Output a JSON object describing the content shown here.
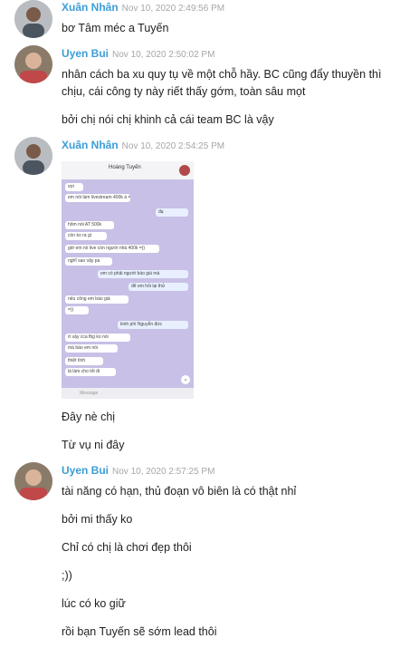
{
  "messages": [
    {
      "name": "Xuân Nhân",
      "time": "Nov 10, 2020 2:49:56 PM",
      "lines": [
        "bơ Tâm méc a Tuyến"
      ]
    },
    {
      "name": "Uyen Bui",
      "time": "Nov 10, 2020 2:50:02 PM",
      "lines": [
        "nhân cách ba xu quy tụ về một chỗ hầy. BC cũng đẩy thuyền thì chịu, cái công ty này riết thấy gớm, toàn sâu mọt",
        "bởi chị nói chị khinh cả cái team BC là vậy"
      ]
    },
    {
      "name": "Xuân Nhân",
      "time": "Nov 10, 2020 2:54:25 PM",
      "lines": [
        "Đây nè chị",
        "Từ vụ ni đây"
      ]
    },
    {
      "name": "Uyen Bui",
      "time": "Nov 10, 2020 2:57:25 PM",
      "lines": [
        "tài năng có hạn, thủ đoạn vô biên là có thật nhỉ",
        "bởi mi thấy ko",
        "Chỉ có chị là chơi đẹp thôi",
        ";))",
        "lúc có ko giữ",
        "rồi bạn Tuyến sẽ sớm lead thôi"
      ]
    }
  ],
  "screenshot": {
    "contact": "Hoàng Tuyến",
    "bubbles": [
      "vợi",
      "em nói làm livestream 400k à =))",
      "đạ",
      "hôm nói AT 500k",
      "còn ko ra gì",
      "giờ em nó live còn người nhà 400k =))",
      "nghĩ sao vậy pa",
      "em có phải người báo giá mà",
      "để em hỏi lại thử",
      "nếu công em báo giá",
      "=))",
      "kinh phí Nguyễn đức",
      "ờ vậy cca fbg ko nói",
      "mà báo em nói",
      "thiệt tình",
      "là làm cho tốt đi",
      "Message"
    ]
  }
}
